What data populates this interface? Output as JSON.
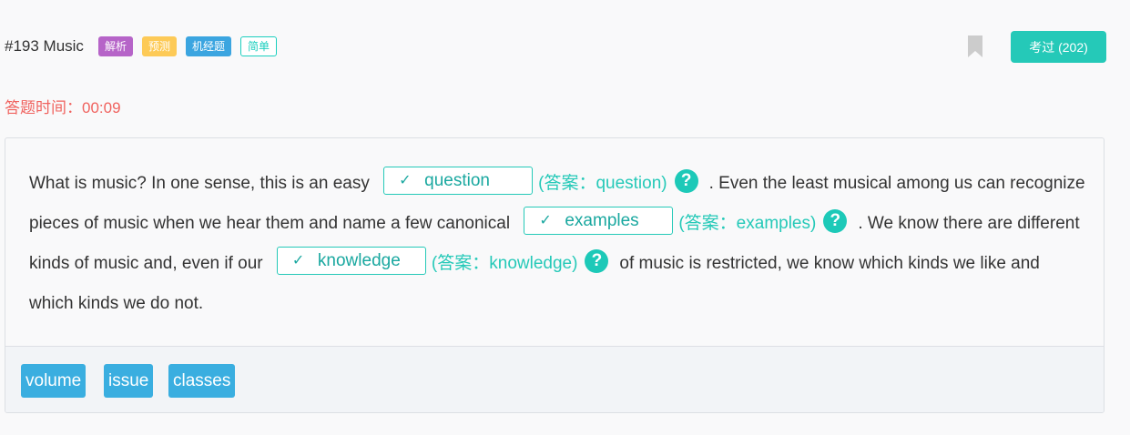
{
  "header": {
    "question_id": "#193 Music",
    "tags": [
      "解析",
      "预测",
      "机经题",
      "简单"
    ],
    "pass_button": "考过 (202)"
  },
  "timer": "答题时间：00:09",
  "passage": {
    "seg1": "What is music? In one sense, this is an easy",
    "blank1": {
      "value": "question",
      "answer": "(答案：question)"
    },
    "seg2": ". Even the least musical among us can recognize pieces of music when we hear them and name a few canonical",
    "blank2": {
      "value": "examples",
      "answer": "(答案：examples)"
    },
    "seg3": ". We know there are different kinds of music and, even if our",
    "blank3": {
      "value": "knowledge",
      "answer": "(答案：knowledge)"
    },
    "seg4": "of music is restricted, we know which kinds we like and which kinds we do not."
  },
  "options": [
    "volume",
    "issue",
    "classes"
  ],
  "icons": {
    "bookmark": "bookmark-icon",
    "check": "check-icon",
    "help": "help-icon"
  },
  "colors": {
    "accent": "#25c9b8",
    "timer": "#f0635f",
    "option_bg": "#3aaee0"
  }
}
